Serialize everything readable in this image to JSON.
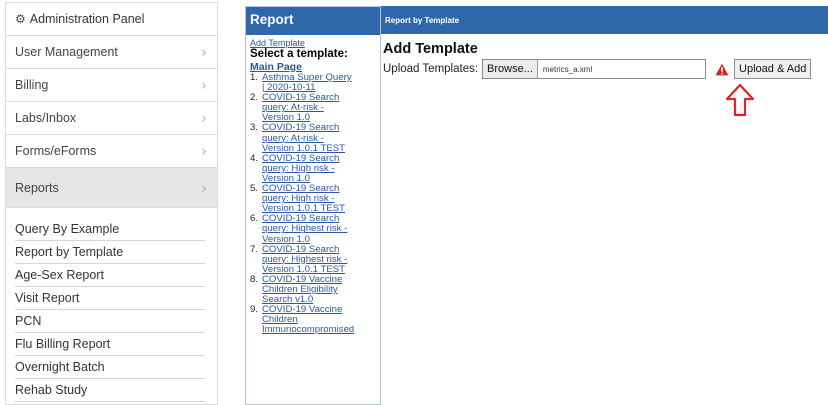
{
  "admin_panel": {
    "title": "Administration Panel",
    "header_icon": "gear-icon",
    "menu": [
      {
        "label": "User Management"
      },
      {
        "label": "Billing"
      },
      {
        "label": "Labs/Inbox"
      },
      {
        "label": "Forms/eForms"
      },
      {
        "label": "Reports"
      }
    ],
    "chevron": "›",
    "submenu": [
      {
        "label": "Query By Example"
      },
      {
        "label": "Report by Template"
      },
      {
        "label": "Age-Sex Report"
      },
      {
        "label": "Visit Report"
      },
      {
        "label": "PCN"
      },
      {
        "label": "Flu Billing Report"
      },
      {
        "label": "Overnight Batch"
      },
      {
        "label": "Rehab Study"
      }
    ]
  },
  "report": {
    "title": "Report",
    "add_template_link": "Add Template",
    "select_label": "Select a template:",
    "main_page_link": "Main Page",
    "templates": [
      {
        "num": "1.",
        "lines": [
          "Asthma Super Query",
          "| 2020-10-11"
        ]
      },
      {
        "num": "2.",
        "lines": [
          "COVID-19 Search",
          "query: At-risk -",
          "Version 1.0"
        ]
      },
      {
        "num": "3.",
        "lines": [
          "COVID-19 Search",
          "query: At-risk -",
          "Version 1.0.1 TEST"
        ]
      },
      {
        "num": "4.",
        "lines": [
          "COVID-19 Search",
          "query: High risk -",
          "Version 1.0"
        ]
      },
      {
        "num": "5.",
        "lines": [
          "COVID-19 Search",
          "query: High risk -",
          "Version 1.0.1 TEST"
        ]
      },
      {
        "num": "6.",
        "lines": [
          "COVID-19 Search",
          "query: Highest risk -",
          "Version 1.0"
        ]
      },
      {
        "num": "7.",
        "lines": [
          "COVID-19 Search",
          "query: Highest risk -",
          "Version 1.0.1 TEST"
        ]
      },
      {
        "num": "8.",
        "lines": [
          "COVID-19 Vaccine",
          "Children Eligibility",
          "Search v1.0"
        ]
      },
      {
        "num": "9.",
        "lines": [
          "COVID-19 Vaccine",
          "Children",
          "Immunocompromised"
        ]
      }
    ]
  },
  "main": {
    "bar_title": "Report by Template",
    "heading": "Add Template",
    "upload_label": "Upload Templates:",
    "browse_label": "Browse...",
    "file_name": "metrics_a.xml",
    "upload_button": "Upload & Add",
    "warning_icon": "warning-triangle-icon",
    "annotation_icon": "arrow-up-icon",
    "colors": {
      "header_blue": "#2f67ab",
      "link_blue": "#2b57a8",
      "warning_red": "#d52020",
      "annotation_red": "#e02424"
    }
  }
}
